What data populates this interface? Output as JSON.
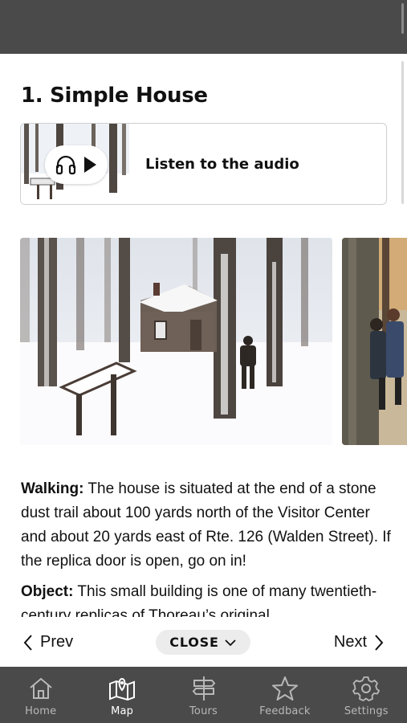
{
  "header": {
    "title": "1. Simple House"
  },
  "audio": {
    "label": "Listen to the audio",
    "icons": [
      "headphones-icon",
      "play-icon"
    ]
  },
  "gallery": {
    "images": [
      "snowy-house-photo",
      "visitors-in-autumn-woods-photo"
    ]
  },
  "content": {
    "walking_label": "Walking:",
    "walking_text": " The house is situated at the end of a stone dust trail about 100 yards north of the Visitor Center and about 20 yards east of Rte. 126 (Walden Street). If the replica door is open, go on in!",
    "object_label": "Object:",
    "object_text": " This small building is one of many twentieth-century replicas of Thoreau’s original"
  },
  "pager": {
    "prev_label": "Prev",
    "close_label": "CLOSE",
    "next_label": "Next"
  },
  "tabbar": {
    "active": "Map",
    "items": [
      {
        "label": "Home",
        "icon": "home-icon"
      },
      {
        "label": "Map",
        "icon": "map-icon"
      },
      {
        "label": "Tours",
        "icon": "signpost-icon"
      },
      {
        "label": "Feedback",
        "icon": "star-icon"
      },
      {
        "label": "Settings",
        "icon": "gear-icon"
      }
    ]
  },
  "colors": {
    "chrome": "#4a4a4a",
    "tab_inactive": "#b8b8b8",
    "tab_active": "#ffffff",
    "close_pill": "#ececec"
  }
}
